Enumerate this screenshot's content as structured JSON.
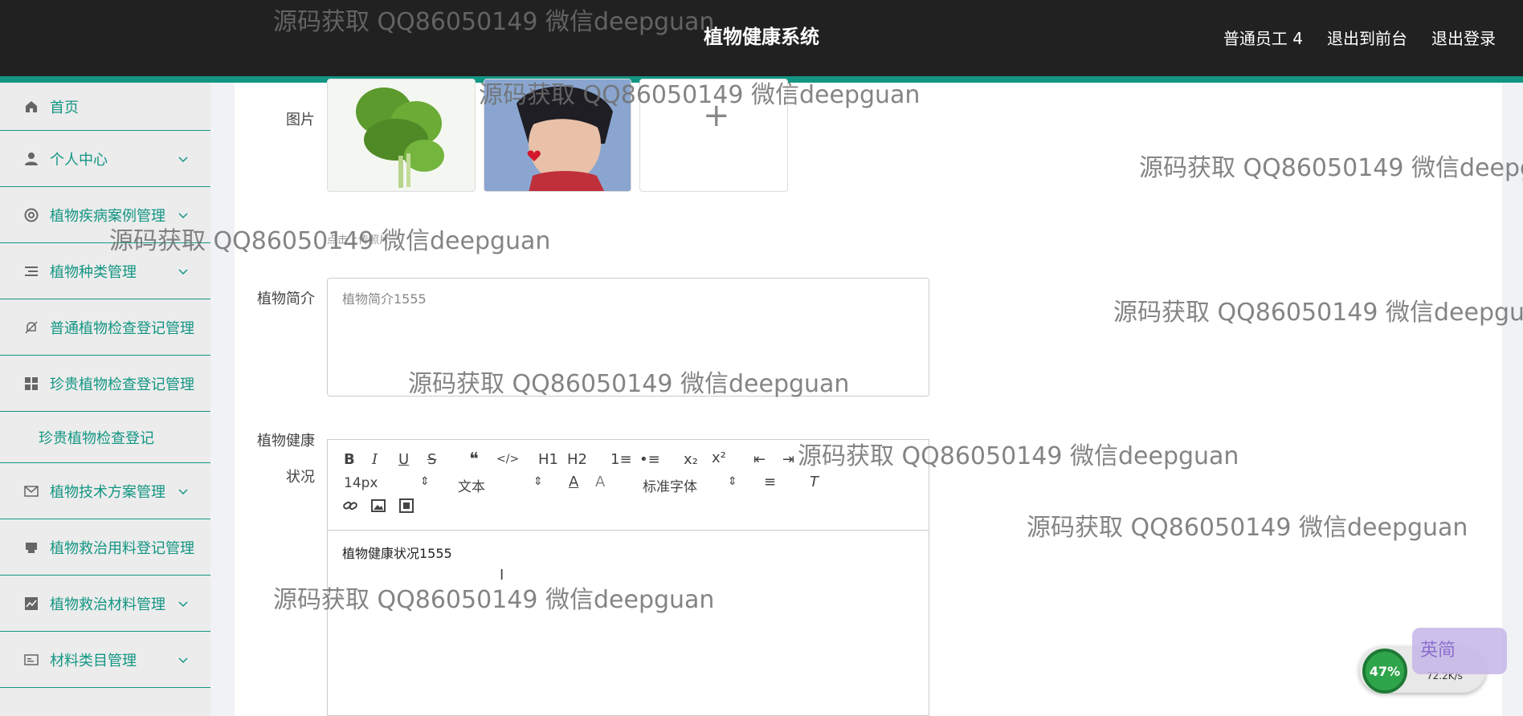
{
  "header": {
    "title": "植物健康系统",
    "links": [
      "普通员工 4",
      "退出到前台",
      "退出登录"
    ]
  },
  "sidebar": {
    "items": [
      {
        "label": "首页",
        "icon": "home-icon",
        "has_arrow": false
      },
      {
        "label": "个人中心",
        "icon": "user-icon",
        "has_arrow": true
      },
      {
        "label": "植物疾病案例管理",
        "icon": "lifebuoy-icon",
        "has_arrow": true
      },
      {
        "label": "植物种类管理",
        "icon": "list-icon",
        "has_arrow": true
      },
      {
        "label": "普通植物检查登记管理",
        "icon": "bell-off-icon",
        "has_arrow": false
      },
      {
        "label": "珍贵植物检查登记管理",
        "icon": "grid-icon",
        "has_arrow": false
      },
      {
        "label": "植物技术方案管理",
        "icon": "mail-icon",
        "has_arrow": true
      },
      {
        "label": "植物救治用料登记管理",
        "icon": "printer-icon",
        "has_arrow": false
      },
      {
        "label": "植物救治材料管理",
        "icon": "chart-icon",
        "has_arrow": true
      },
      {
        "label": "材料类目管理",
        "icon": "id-card-icon",
        "has_arrow": true
      }
    ],
    "sub_item": "珍贵植物检查登记"
  },
  "form": {
    "image_label": "图片",
    "upload_hint": "点击上传照片",
    "plus_sign": "+",
    "intro_label": "植物简介",
    "intro_value": "植物简介1555",
    "health_label_line1": "植物健康",
    "health_label_line2": "状况",
    "editor_content": "植物健康状况1555"
  },
  "editor_toolbar": {
    "font_size": "14px",
    "text_type": "文本",
    "font_family": "标准字体",
    "buttons": [
      "B",
      "I",
      "U",
      "S",
      "❝",
      "</>",
      "H1",
      "H2",
      "1≡",
      "•≡",
      "x₂",
      "x²",
      "⇤",
      "⇥"
    ]
  },
  "watermark_text": "源码获取 QQ86050149 微信deepguan",
  "tray": {
    "percent": "47%",
    "speed": "72.2K/s",
    "ime": "英简"
  },
  "colors": {
    "accent": "#129683",
    "topbar": "#212121",
    "sidebar_bg": "#ececec"
  }
}
